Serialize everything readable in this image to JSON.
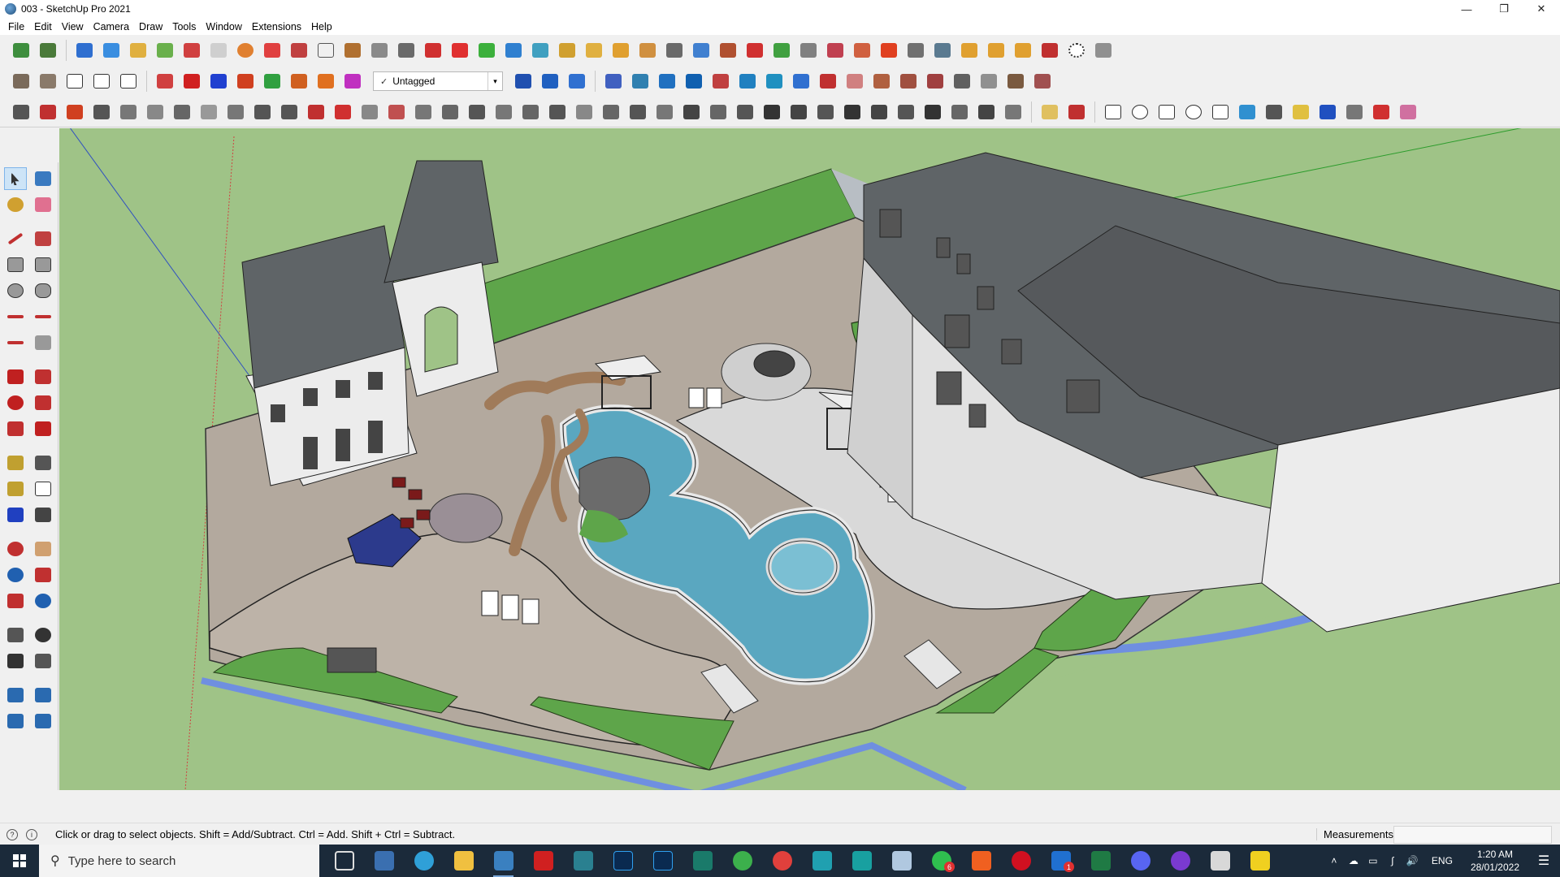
{
  "window": {
    "title": "003 - SketchUp Pro 2021",
    "controls": {
      "minimize": "—",
      "maximize": "❐",
      "close": "✕"
    }
  },
  "menu": [
    "File",
    "Edit",
    "View",
    "Camera",
    "Draw",
    "Tools",
    "Window",
    "Extensions",
    "Help"
  ],
  "toolbar": {
    "tag_select": {
      "check": "✓",
      "value": "Untagged",
      "arrow": "▾"
    }
  },
  "viewport": {
    "colors": {
      "ground": "#9fc387",
      "grass": "#5ea54a",
      "paving": "#b3a99e",
      "concrete": "#d9d9d9",
      "water": "#5aa7c0",
      "roof": "#5f6467",
      "wall": "#ececec",
      "edge_blue": "#6f8fe0"
    }
  },
  "status": {
    "message": "Click or drag to select objects. Shift = Add/Subtract. Ctrl = Add. Shift + Ctrl = Subtract.",
    "measurements_label": "Measurements",
    "measurements_value": ""
  },
  "taskbar": {
    "search_placeholder": "Type here to search",
    "badges": {
      "whatsapp": "6",
      "vscode": "1"
    },
    "language": "ENG",
    "time": "1:20 AM",
    "date": "28/01/2022"
  }
}
